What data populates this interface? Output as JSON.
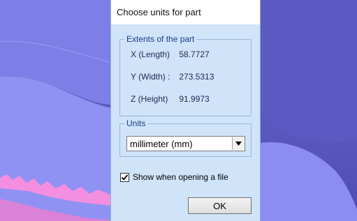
{
  "dialog": {
    "title": "Choose units for part",
    "extents": {
      "group_label": "Extents of the part",
      "rows": [
        {
          "label": "X (Length)",
          "value": "58.7727"
        },
        {
          "label": "Y (Width) :",
          "value": "273.5313"
        },
        {
          "label": "Z (Height)",
          "value": "91.9973"
        }
      ]
    },
    "units": {
      "group_label": "Units",
      "selected": "millimeter (mm)"
    },
    "show_on_open": {
      "label": "Show when opening a file",
      "checked": true
    },
    "ok_label": "OK"
  },
  "colors": {
    "viewport_bg": "#5a58bd",
    "model_surface": "#8d8ff0",
    "dialog_bg": "#cfe3f9",
    "accent_pink": "#ff7fd6"
  }
}
